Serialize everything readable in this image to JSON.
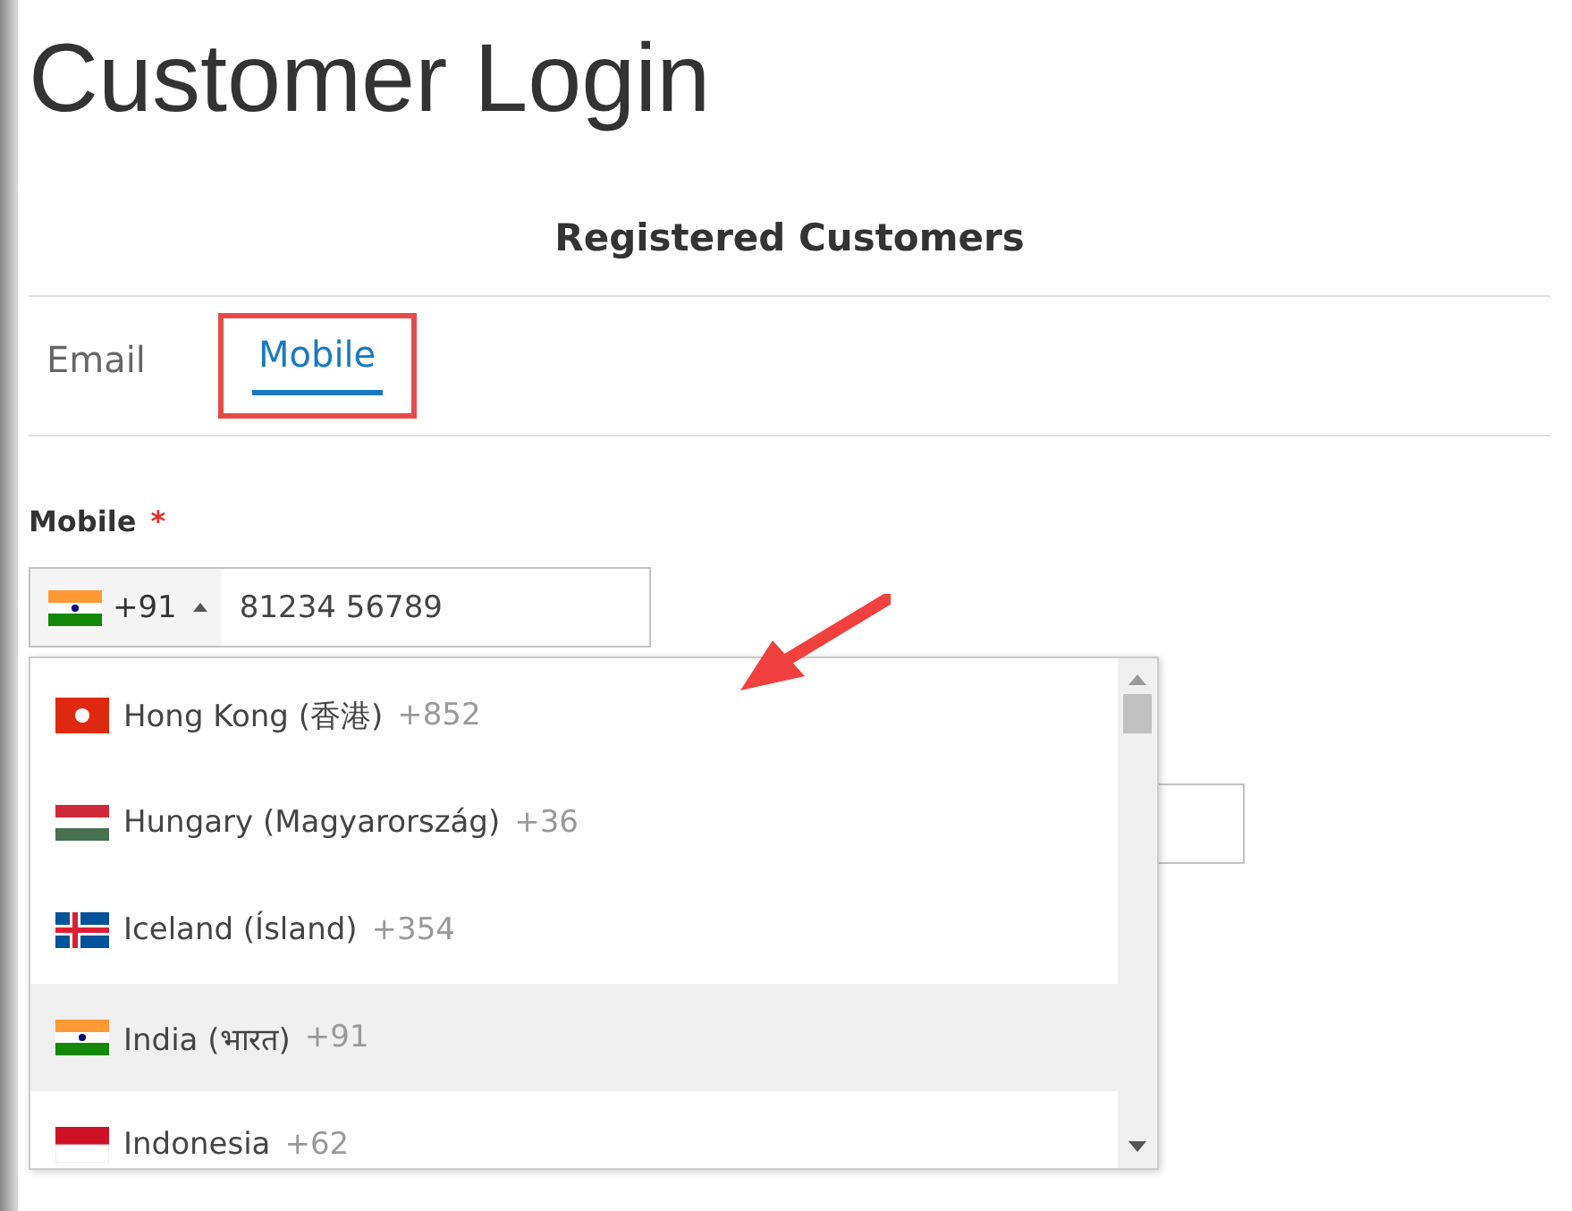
{
  "page_title": "Customer Login",
  "section_title": "Registered Customers",
  "tabs": [
    {
      "label": "Email",
      "selected": false
    },
    {
      "label": "Mobile",
      "selected": true
    }
  ],
  "mobile_field": {
    "label": "Mobile",
    "required_mark": "*",
    "dial_code": "+91",
    "value": "81234 56789",
    "expanded": true
  },
  "countries": [
    {
      "name": "Hong Kong (香港)",
      "code": "+852",
      "selected": false
    },
    {
      "name": "Hungary (Magyarország)",
      "code": "+36",
      "selected": false
    },
    {
      "name": "Iceland (Ísland)",
      "code": "+354",
      "selected": false
    },
    {
      "name": "India (भारत)",
      "code": "+91",
      "selected": true
    },
    {
      "name": "Indonesia",
      "code": "+62",
      "selected": false
    }
  ]
}
